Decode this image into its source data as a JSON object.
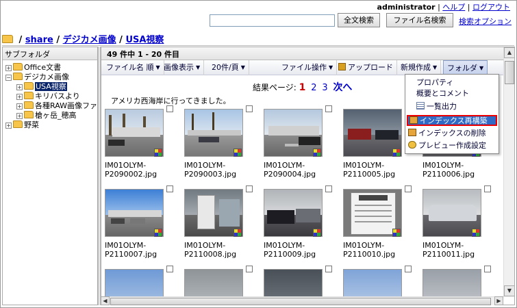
{
  "header": {
    "user": "administrator",
    "separator": "|",
    "help": "ヘルプ",
    "logout": "ログアウト",
    "search_value": "",
    "fulltext_button": "全文検索",
    "filename_button": "ファイル名検索",
    "search_options": "検索オプション"
  },
  "breadcrumb": {
    "root": "/",
    "share": "share",
    "sep1": "/",
    "camera": "デジカメ画像",
    "sep2": "/",
    "current": "USA視察"
  },
  "sidebar": {
    "title": "サブフォルダ",
    "items": [
      {
        "label": "Office文書"
      },
      {
        "label": "デジカメ画像"
      },
      {
        "label": "USA視察"
      },
      {
        "label": "キリバスより"
      },
      {
        "label": "各種RAW画像ファ"
      },
      {
        "label": "槍ヶ岳_穂高"
      },
      {
        "label": "野菜"
      }
    ]
  },
  "content": {
    "count_text": "49 件中 1 - 20 件目",
    "toolbar": {
      "sort": "ファイル名 順",
      "view": "画像表示",
      "per_page": "20件/頁",
      "file_ops": "ファイル操作",
      "upload": "アップロード",
      "new": "新規作成",
      "folder": "フォルダ"
    },
    "pager": {
      "label": "結果ページ:",
      "current": "1",
      "p2": "2",
      "p3": "3",
      "next": "次へ"
    },
    "description": "アメリカ西海岸に行ってきました。",
    "files": [
      {
        "line1": "IM01OLYM-",
        "line2": "P2090002.jpg"
      },
      {
        "line1": "IM01OLYM-",
        "line2": "P2090003.jpg"
      },
      {
        "line1": "IM01OLYM-",
        "line2": "P2090004.jpg"
      },
      {
        "line1": "IM01OLYM-",
        "line2": "P2110005.jpg"
      },
      {
        "line1": "IM01OLYM-",
        "line2": "P2110006.jpg"
      },
      {
        "line1": "IM01OLYM-",
        "line2": "P2110007.jpg"
      },
      {
        "line1": "IM01OLYM-",
        "line2": "P2110008.jpg"
      },
      {
        "line1": "IM01OLYM-",
        "line2": "P2110009.jpg"
      },
      {
        "line1": "IM01OLYM-",
        "line2": "P2110010.jpg"
      },
      {
        "line1": "IM01OLYM-",
        "line2": "P2110011.jpg"
      }
    ]
  },
  "folder_menu": {
    "items": [
      {
        "label": "プロパティ"
      },
      {
        "label": "概要とコメント"
      },
      {
        "label": "一覧出力"
      },
      {
        "label": "インデックス再構築"
      },
      {
        "label": "インデックスの削除"
      },
      {
        "label": "プレビュー作成設定"
      }
    ]
  },
  "colors": {
    "link": "#0000cc",
    "selection": "#0a246a",
    "highlight_border": "#ee0000",
    "pager_current": "#cc0000"
  }
}
